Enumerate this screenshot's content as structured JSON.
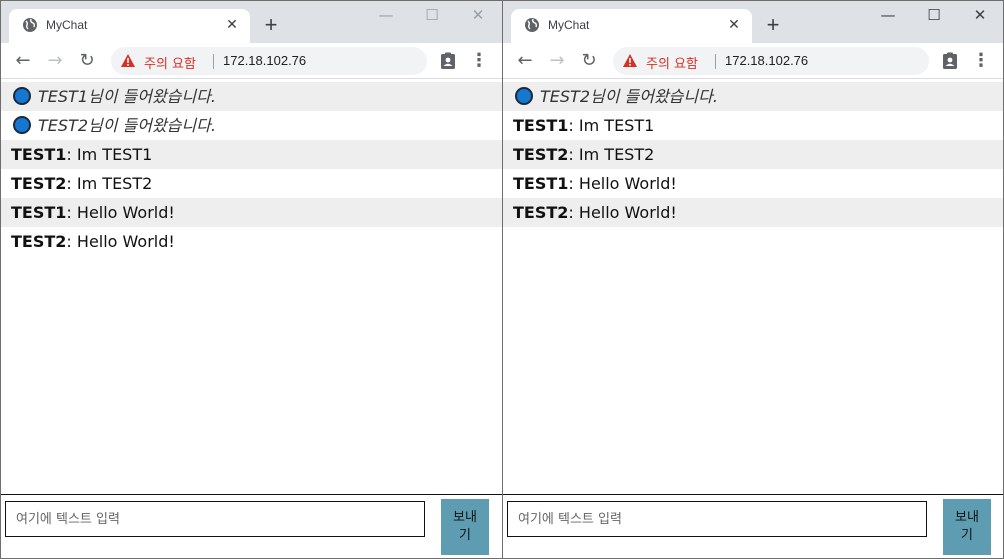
{
  "windows": [
    {
      "tab_title": "MyChat",
      "security_label": "주의 요함",
      "url": "172.18.102.76",
      "messages": [
        {
          "type": "system",
          "text": "TEST1님이 들어왔습니다."
        },
        {
          "type": "system",
          "text": "TEST2님이 들어왔습니다."
        },
        {
          "type": "chat",
          "sender": "TEST1",
          "text": "Im TEST1"
        },
        {
          "type": "chat",
          "sender": "TEST2",
          "text": "Im TEST2"
        },
        {
          "type": "chat",
          "sender": "TEST1",
          "text": "Hello World!"
        },
        {
          "type": "chat",
          "sender": "TEST2",
          "text": "Hello World!"
        }
      ],
      "input_placeholder": "여기에 텍스트 입력",
      "send_label": "보내기"
    },
    {
      "tab_title": "MyChat",
      "security_label": "주의 요함",
      "url": "172.18.102.76",
      "messages": [
        {
          "type": "system",
          "text": "TEST2님이 들어왔습니다."
        },
        {
          "type": "chat",
          "sender": "TEST1",
          "text": "Im TEST1"
        },
        {
          "type": "chat",
          "sender": "TEST2",
          "text": "Im TEST2"
        },
        {
          "type": "chat",
          "sender": "TEST1",
          "text": "Hello World!"
        },
        {
          "type": "chat",
          "sender": "TEST2",
          "text": "Hello World!"
        }
      ],
      "input_placeholder": "여기에 텍스트 입력",
      "send_label": "보내기"
    }
  ],
  "colors": {
    "system_dot": "#1677d2",
    "send_button": "#5e9cb1",
    "warning": "#d93025",
    "row_shade": "#eeeeee"
  },
  "icons": {
    "tab_favicon": "globe-icon",
    "tab_close": "close-icon",
    "new_tab": "plus-icon",
    "back": "arrow-left-icon",
    "forward": "arrow-right-icon",
    "reload": "reload-icon",
    "security": "warning-triangle-icon",
    "profile": "clipboard-account-icon",
    "menu": "kebab-menu-icon",
    "minimize": "minimize-icon",
    "maximize": "maximize-icon",
    "close_window": "close-window-icon"
  }
}
